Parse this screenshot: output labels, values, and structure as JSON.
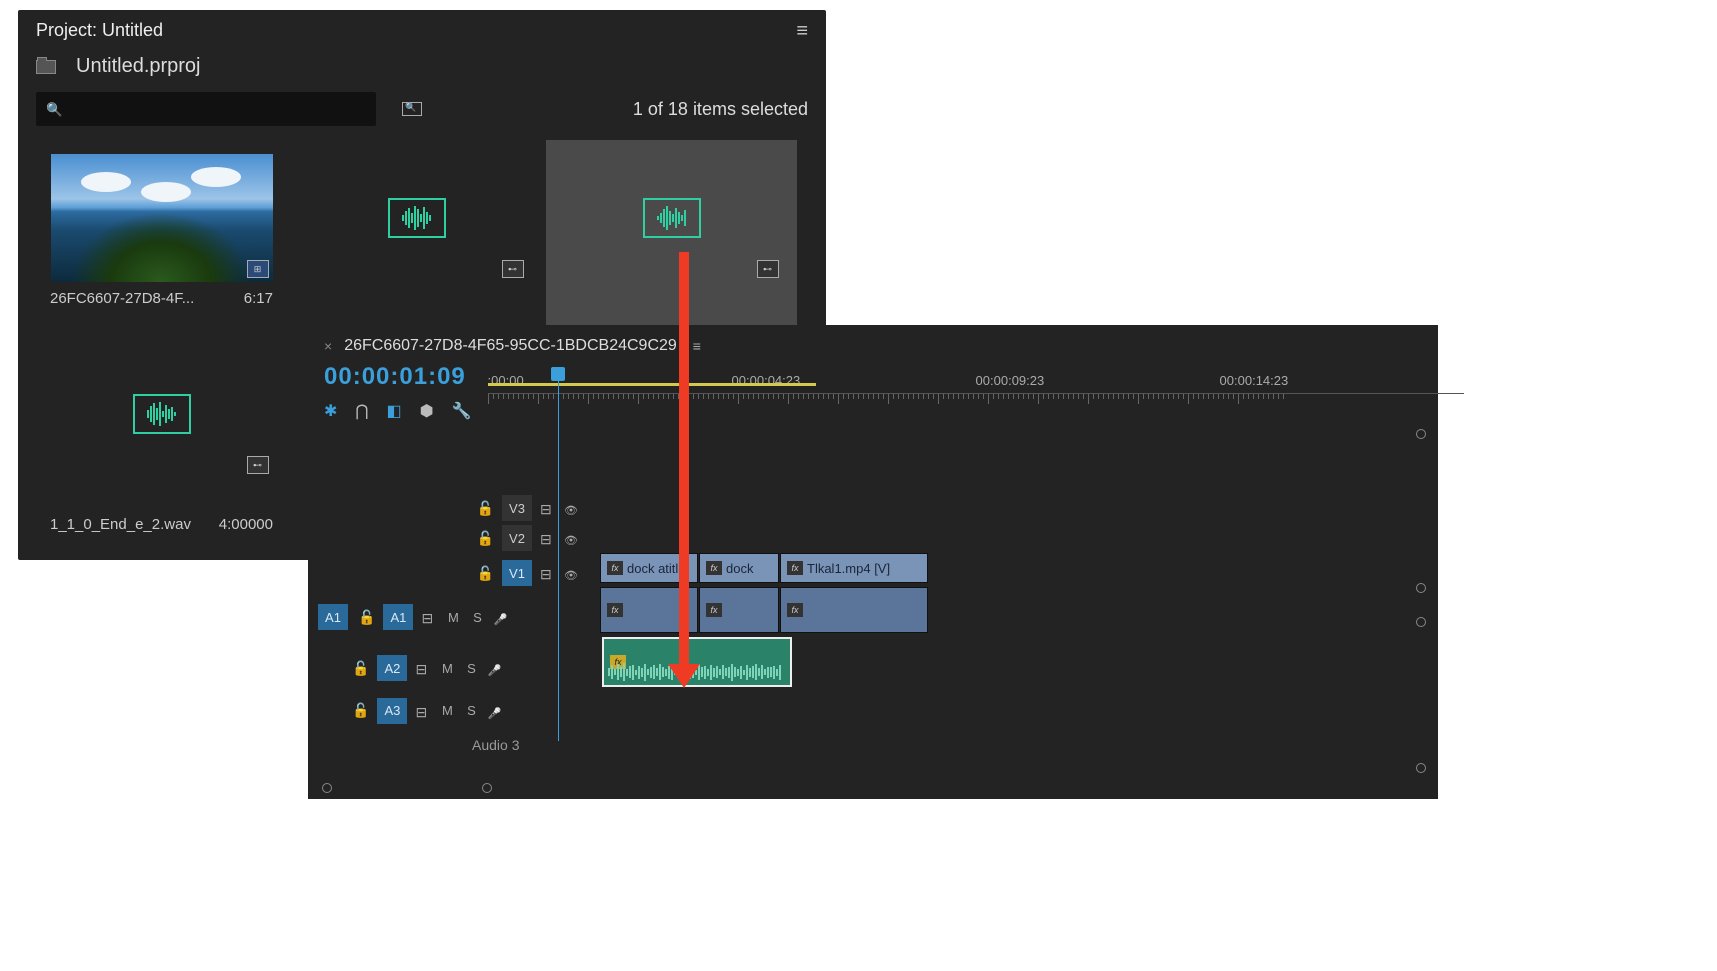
{
  "project": {
    "panel_title": "Project: Untitled",
    "filename": "Untitled.prproj",
    "search_placeholder": "🔍",
    "selection_status": "1 of 18 items selected",
    "items": [
      {
        "name": "26FC6607-27D8-4F...",
        "duration": "6:17",
        "type": "sequence",
        "selected": false
      },
      {
        "name": "",
        "duration": "",
        "type": "audio",
        "selected": false
      },
      {
        "name": "",
        "duration": "",
        "type": "audio",
        "selected": true
      },
      {
        "name": "1_1_0_End_e_2.wav",
        "duration": "4:00000",
        "type": "audio",
        "selected": false
      }
    ]
  },
  "timeline": {
    "sequence_name": "26FC6607-27D8-4F65-95CC-1BDCB24C9C29",
    "timecode": "00:00:01:09",
    "ruler_labels": [
      ":00:00",
      "00:00:04:23",
      "00:00:09:23",
      "00:00:14:23"
    ],
    "tracks": {
      "video": [
        {
          "id": "V3",
          "active": false
        },
        {
          "id": "V2",
          "active": false
        },
        {
          "id": "V1",
          "active": true
        }
      ],
      "audio": [
        {
          "id": "A1",
          "source_patch": "A1",
          "active": true
        },
        {
          "id": "A2",
          "active": true
        },
        {
          "id": "A3",
          "active": true,
          "label": "Audio 3"
        }
      ]
    },
    "clips": {
      "v1": [
        {
          "name": "dock atitl"
        },
        {
          "name": "dock"
        },
        {
          "name": "Tlkal1.mp4 [V]"
        }
      ],
      "a2_music": {
        "fx": "fx"
      }
    },
    "controls": {
      "mute": "M",
      "solo": "S"
    }
  }
}
